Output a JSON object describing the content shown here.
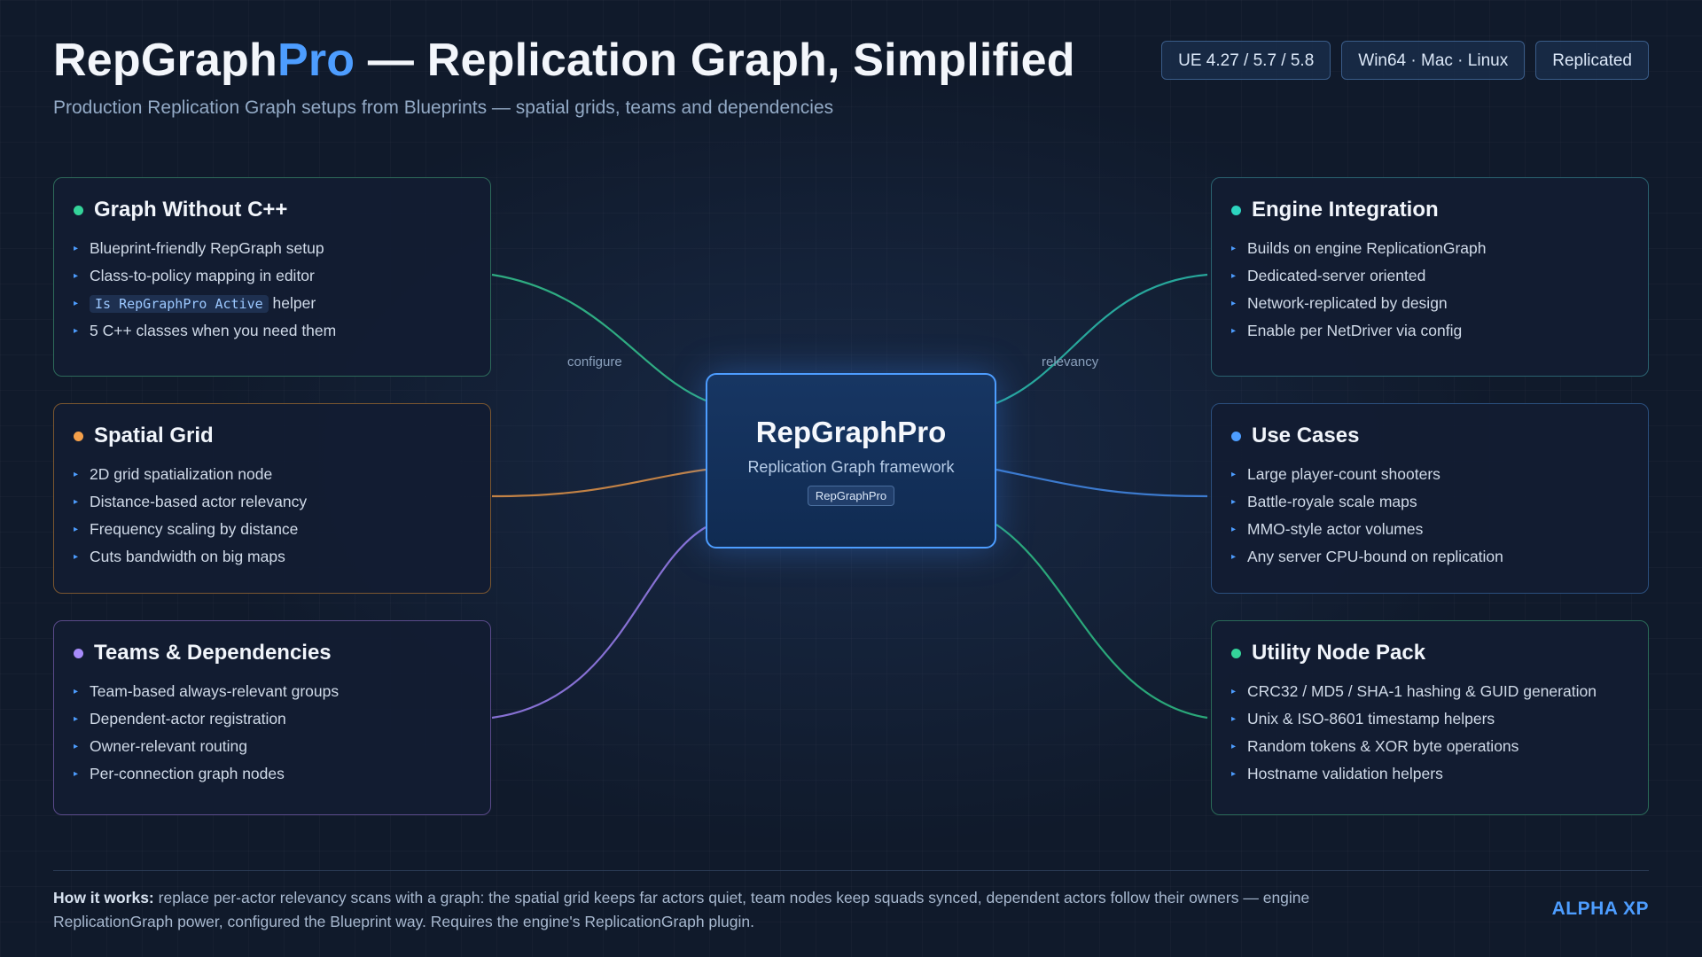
{
  "header": {
    "title_main": "RepGraph",
    "title_accent": "Pro",
    "title_rest": " — Replication Graph, Simplified",
    "subtitle": "Production Replication Graph setups from Blueprints — spatial grids, teams and dependencies",
    "badges": [
      "UE 4.27 / 5.7 / 5.8",
      "Win64 · Mac · Linux",
      "Replicated"
    ]
  },
  "center": {
    "title": "RepGraphPro",
    "subtitle": "Replication Graph framework",
    "tag": "RepGraphPro"
  },
  "link_labels": {
    "left_top": "configure",
    "right_top": "relevancy"
  },
  "cards": [
    {
      "title": "Graph Without C++",
      "color": "#34d399",
      "items": [
        "Blueprint-friendly RepGraph setup",
        "Class-to-policy mapping in editor",
        "helper",
        "5 C++ classes when you need them"
      ],
      "code": "Is RepGraphPro Active"
    },
    {
      "title": "Spatial Grid",
      "color": "#f5a04a",
      "items": [
        "2D grid spatialization node",
        "Distance-based actor relevancy",
        "Frequency scaling by distance",
        "Cuts bandwidth on big maps"
      ]
    },
    {
      "title": "Teams & Dependencies",
      "color": "#a78bfa",
      "items": [
        "Team-based always-relevant groups",
        "Dependent-actor registration",
        "Owner-relevant routing",
        "Per-connection graph nodes"
      ]
    },
    {
      "title": "Engine Integration",
      "color": "#2dd4bf",
      "items": [
        "Builds on engine ReplicationGraph",
        "Dedicated-server oriented",
        "Network-replicated by design",
        "Enable per NetDriver via config"
      ]
    },
    {
      "title": "Use Cases",
      "color": "#4d9dff",
      "items": [
        "Large player-count shooters",
        "Battle-royale scale maps",
        "MMO-style actor volumes",
        "Any server CPU-bound on replication"
      ]
    },
    {
      "title": "Utility Node Pack",
      "color": "#34d399",
      "items": [
        "CRC32 / MD5 / SHA-1 hashing & GUID generation",
        "Unix & ISO-8601 timestamp helpers",
        "Random tokens & XOR byte operations",
        "Hostname validation helpers"
      ]
    }
  ],
  "footer": {
    "lead": "How it works:",
    "text": " replace per-actor relevancy scans with a graph: the spatial grid keeps far actors quiet, team nodes keep squads synced, dependent actors follow their owners — engine ReplicationGraph power, configured the Blueprint way. Requires the engine's ReplicationGraph plugin.",
    "brand": "ALPHA XP"
  }
}
